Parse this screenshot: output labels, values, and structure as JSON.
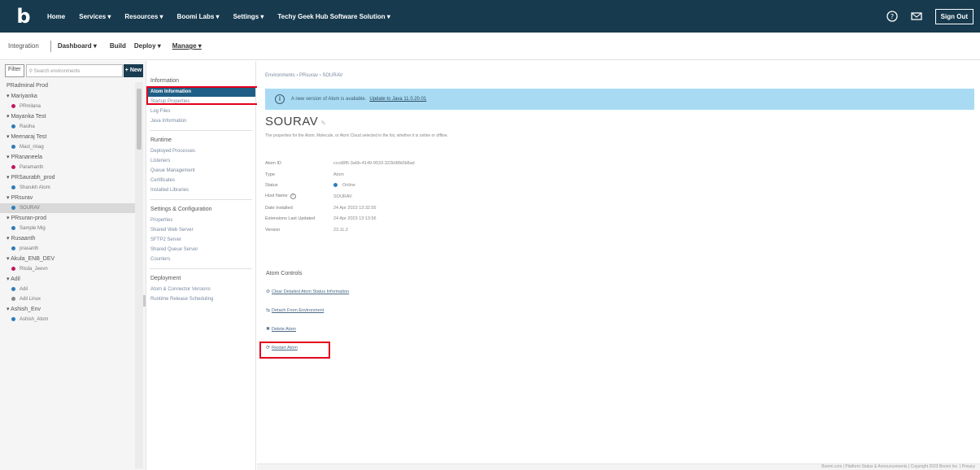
{
  "topnav": {
    "items": [
      "Home",
      "Services ▾",
      "Resources ▾",
      "Boomi Labs ▾",
      "Settings ▾",
      "Techy Geek Hub Software Solution ▾"
    ],
    "sign_out": "Sign Out"
  },
  "subnav": {
    "integration": "Integration",
    "dashboard": "Dashboard ▾",
    "build": "Build",
    "deploy": "Deploy ▾",
    "manage": "Manage ▾"
  },
  "envpanel": {
    "filter": "Filter",
    "search_placeholder": "Search environments",
    "new": "+ New",
    "list": [
      {
        "type": "group",
        "label": "PRadminal Prod"
      },
      {
        "type": "group",
        "label": "▾ Mariyanka"
      },
      {
        "type": "atom",
        "label": "PRmilana",
        "color": "#c2185b"
      },
      {
        "type": "group",
        "label": "▾ Mayanka Test"
      },
      {
        "type": "atom",
        "label": "Rasiha",
        "color": "#2f7cb8"
      },
      {
        "type": "group",
        "label": "▾ Meenaraj Test"
      },
      {
        "type": "atom",
        "label": "Mast_rinag",
        "color": "#2f7cb8"
      },
      {
        "type": "group",
        "label": "▾ PRananeela"
      },
      {
        "type": "atom",
        "label": "Paramanth",
        "color": "#c2185b"
      },
      {
        "type": "group",
        "label": "▾ PRSaurabh_prod"
      },
      {
        "type": "atom",
        "label": "Sharukh Atom",
        "color": "#2f7cb8"
      },
      {
        "type": "group",
        "label": "▾ PRsurav"
      },
      {
        "type": "atom",
        "label": "SOURAV",
        "color": "#2f7cb8",
        "selected": true
      },
      {
        "type": "group",
        "label": "▾ PRsuran-prod"
      },
      {
        "type": "atom",
        "label": "Sample Mig",
        "color": "#2f7cb8"
      },
      {
        "type": "group",
        "label": "▾ Rusaanth"
      },
      {
        "type": "atom",
        "label": "prasanth",
        "color": "#2f7cb8"
      },
      {
        "type": "group",
        "label": "▾ Akula_ENB_DEV"
      },
      {
        "type": "atom",
        "label": "Rlsda_Jeevn",
        "color": "#c2185b"
      },
      {
        "type": "group",
        "label": "▾ Adil"
      },
      {
        "type": "atom",
        "label": "Adil",
        "color": "#2f7cb8"
      },
      {
        "type": "atom",
        "label": "Adil Linux",
        "color": "#888888"
      },
      {
        "type": "group",
        "label": "▾ Ashish_Env"
      },
      {
        "type": "atom",
        "label": "Ashish_Atom",
        "color": "#2f7cb8"
      }
    ]
  },
  "menu": {
    "sections": [
      {
        "title": "Information",
        "items": [
          {
            "label": "Atom Information",
            "active": true
          },
          {
            "label": "Startup Properties"
          },
          {
            "label": "Log Files"
          },
          {
            "label": "Java Information"
          }
        ]
      },
      {
        "title": "Runtime",
        "items": [
          {
            "label": "Deployed Processes"
          },
          {
            "label": "Listeners"
          },
          {
            "label": "Queue Management"
          },
          {
            "label": "Certificates"
          },
          {
            "label": "Installed Libraries"
          }
        ]
      },
      {
        "title": "Settings & Configuration",
        "items": [
          {
            "label": "Properties"
          },
          {
            "label": "Shared Web Server"
          },
          {
            "label": "SFTP2 Server"
          },
          {
            "label": "Shared Queue Server"
          },
          {
            "label": "Counters"
          }
        ]
      },
      {
        "title": "Deployment",
        "items": [
          {
            "label": "Atom & Connector Versions"
          },
          {
            "label": "Runtime Release Scheduling"
          }
        ]
      }
    ]
  },
  "content": {
    "breadcrumb": "Environments › PRsurav › SOURAV",
    "banner_text": "A new version of Atom is available.",
    "banner_link": "Update to Java 11.0.20.01",
    "atom_name": "SOURAV",
    "description": "The properties for the Atom, Molecule, or Atom Cloud selected in the list, whether it is online or offline.",
    "properties": [
      {
        "label": "Atom ID",
        "value": "cccd8f6-3a6b-4149-9533-322b98b0b8ad"
      },
      {
        "label": "Type",
        "value": "Atom"
      },
      {
        "label": "Status",
        "value": "Online",
        "status_dot": true
      },
      {
        "label": "Host Name",
        "value": "SOURAV",
        "help": true
      },
      {
        "label": "Date Installed",
        "value": "24 Apr 2023 13:32:55"
      },
      {
        "label": "Extensions Last Updated",
        "value": "24 Apr 2023 13:13:56"
      },
      {
        "label": "Version",
        "value": "23.11.2"
      }
    ],
    "controls_title": "Atom Controls",
    "controls": [
      {
        "icon": "⊘",
        "label": "Clear Detailed Atom Status Information"
      },
      {
        "icon": "⇆",
        "label": "Detach From Environment"
      },
      {
        "icon": "✖",
        "label": "Delete Atom"
      },
      {
        "icon": "⟳",
        "label": "Restart Atom"
      }
    ]
  },
  "footer": "Boomi.com  |  Platform Status & Announcements  |  Copyright 2023 Boomi Inc.  |  Privacy"
}
